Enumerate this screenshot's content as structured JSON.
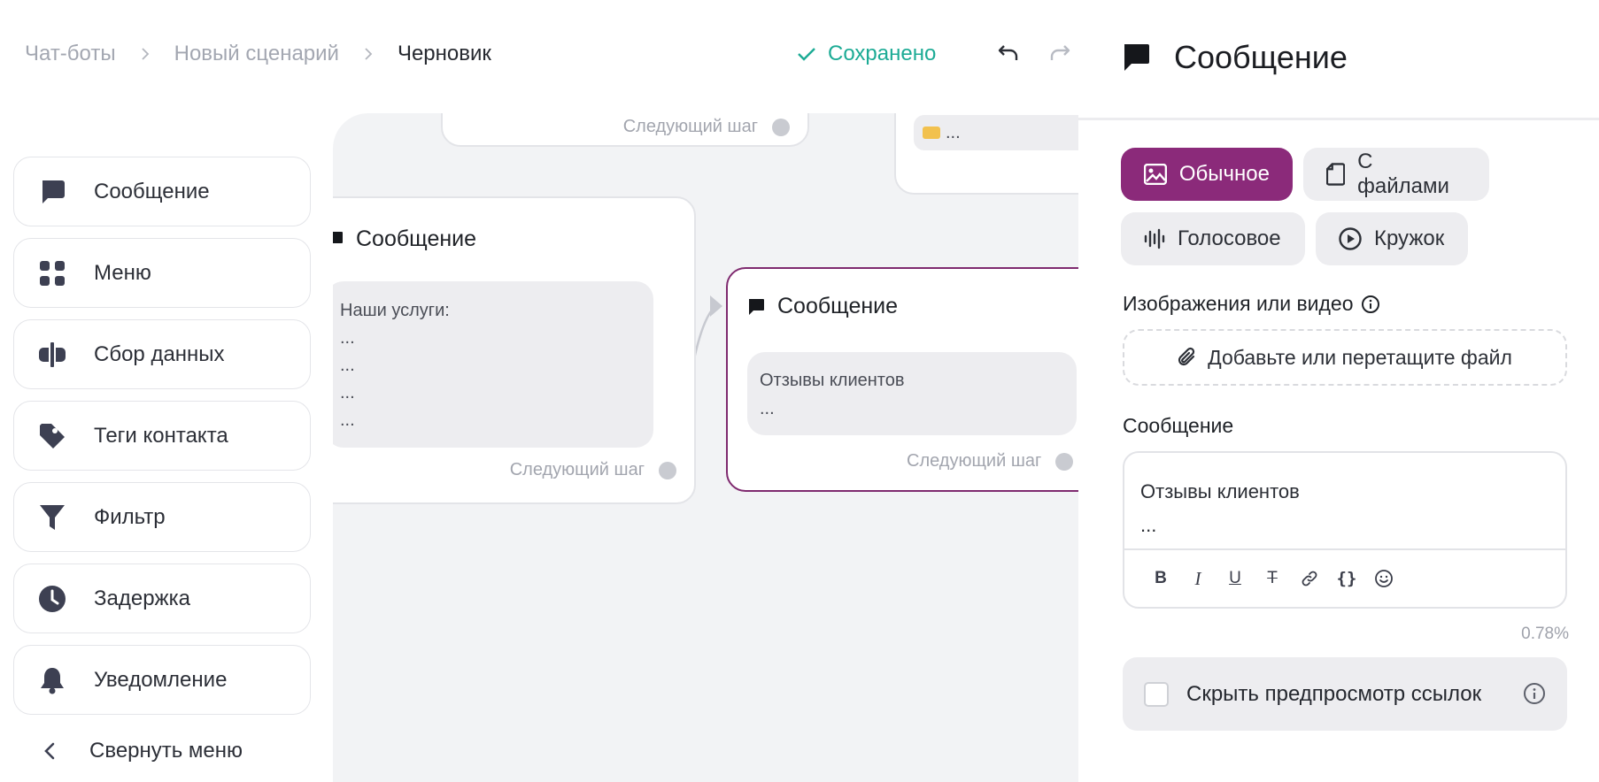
{
  "breadcrumb": {
    "items": [
      "Чат-боты",
      "Новый сценарий",
      "Черновик"
    ]
  },
  "header": {
    "saved_status": "Сохранено"
  },
  "block_menu": {
    "items": [
      {
        "label": "Сообщение",
        "icon": "chat-bubble-icon"
      },
      {
        "label": "Меню",
        "icon": "grid-icon"
      },
      {
        "label": "Сбор данных",
        "icon": "text-cursor-icon"
      },
      {
        "label": "Теги контакта",
        "icon": "tag-icon"
      },
      {
        "label": "Фильтр",
        "icon": "filter-icon"
      },
      {
        "label": "Задержка",
        "icon": "clock-icon"
      },
      {
        "label": "Уведомление",
        "icon": "bell-icon"
      }
    ],
    "collapse_label": "Свернуть меню"
  },
  "canvas": {
    "top_node_next": "Следующий шаг",
    "top_right_node_text": "...",
    "node_services": {
      "title": "Сообщение",
      "lines": [
        "Наши услуги:",
        "...",
        "...",
        "...",
        "..."
      ],
      "next": "Следующий шаг"
    },
    "node_reviews": {
      "title": "Сообщение",
      "lines": [
        "Отзывы клиентов",
        "..."
      ],
      "next": "Следующий шаг"
    }
  },
  "panel": {
    "title": "Сообщение",
    "types": {
      "regular": "Обычное",
      "files": "С файлами",
      "voice": "Голосовое",
      "circle": "Кружок"
    },
    "media_label": "Изображения или видео",
    "upload_label": "Добавьте или перетащите файл",
    "message_label": "Сообщение",
    "message_lines": [
      "Отзывы клиентов",
      "..."
    ],
    "toolbar": {
      "bold": "B",
      "italic": "I",
      "underline": "U",
      "strike": "T",
      "braces": "{}"
    },
    "counter": "0.78%",
    "hide_preview_label": "Скрыть предпросмотр ссылок",
    "hide_preview_checked": false
  },
  "colors": {
    "accent": "#8b2a7a",
    "saved": "#1cab95",
    "canvas_bg": "#f2f3f5"
  }
}
